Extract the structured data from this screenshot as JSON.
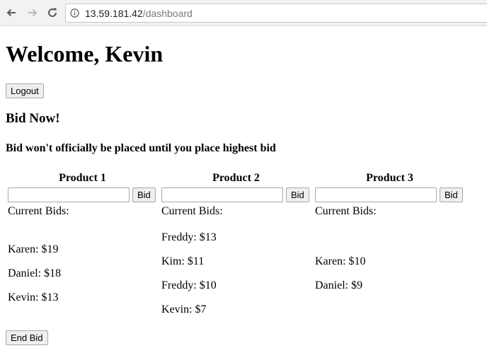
{
  "browser": {
    "url_host": "13.59.181.42",
    "url_path": "/dashboard"
  },
  "page": {
    "welcome": "Welcome, Kevin",
    "logout_label": "Logout",
    "bid_now": "Bid Now!",
    "bid_note": "Bid won't officially be placed until you place highest bid",
    "current_bids_label": "Current Bids:",
    "bid_button_label": "Bid",
    "end_bid_label": "End Bid"
  },
  "products": [
    {
      "title": "Product 1",
      "bids": [
        "Karen: $19",
        "Daniel: $18",
        "Kevin: $13"
      ]
    },
    {
      "title": "Product 2",
      "bids": [
        "Freddy: $13",
        "Kim: $11",
        "Freddy: $10",
        "Kevin: $7"
      ]
    },
    {
      "title": "Product 3",
      "bids": [
        "Karen: $10",
        "Daniel: $9"
      ]
    }
  ]
}
